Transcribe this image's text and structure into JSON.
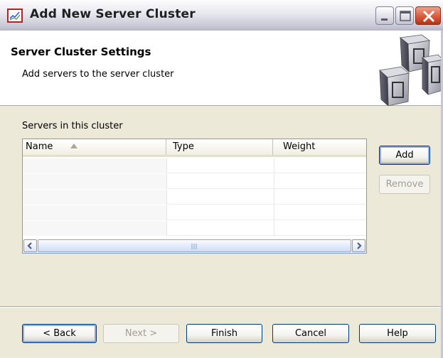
{
  "window": {
    "title": "Add New Server Cluster"
  },
  "header": {
    "title": "Server Cluster Settings",
    "subtitle": "Add servers to the server cluster",
    "image_icon": "servers-cluster-icon"
  },
  "servers_group": {
    "label": "Servers in this cluster",
    "columns": [
      "Name",
      "Type",
      "Weight"
    ],
    "sort_column": "Name",
    "sort_direction": "ascending",
    "rows": [],
    "visible_empty_rows": 5
  },
  "side_buttons": {
    "add": "Add",
    "remove": "Remove"
  },
  "footer_buttons": {
    "back": "< Back",
    "next": "Next >",
    "finish": "Finish",
    "cancel": "Cancel",
    "help": "Help"
  },
  "colors": {
    "dialog_background": "#ece9d8",
    "button_border": "#003c74",
    "close_button": "#d95b3c"
  }
}
